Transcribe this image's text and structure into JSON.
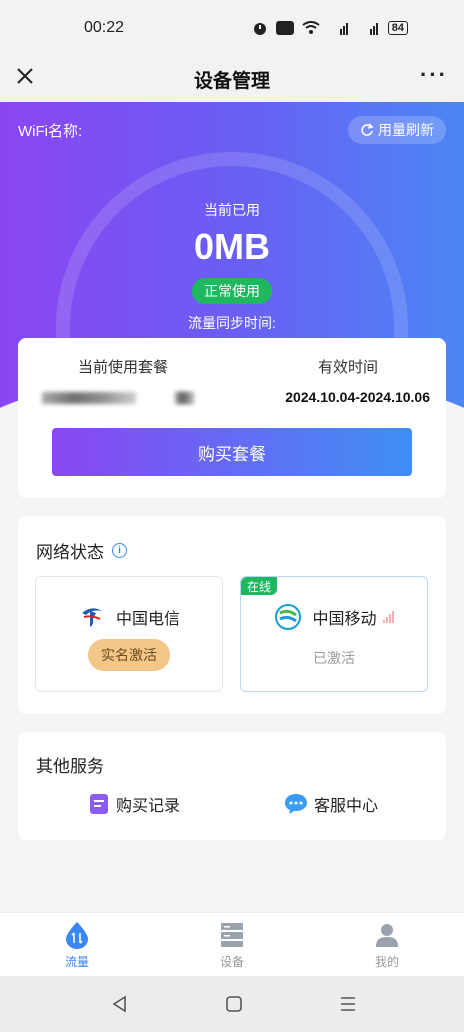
{
  "status_bar": {
    "time": "00:22",
    "battery": "84"
  },
  "header": {
    "title": "设备管理"
  },
  "hero": {
    "wifi_label": "WiFi名称:",
    "refresh_label": "用量刷新",
    "used_label": "当前已用",
    "used_value": "0MB",
    "status": "正常使用",
    "sync_label": "流量同步时间:"
  },
  "plan": {
    "col1_header": "当前使用套餐",
    "col2_header": "有效时间",
    "valid_dates": "2024.10.04-2024.10.06",
    "buy_label": "购买套餐"
  },
  "network": {
    "title": "网络状态",
    "carriers": [
      {
        "name": "中国电信",
        "state": "实名激活"
      },
      {
        "name": "中国移动",
        "state": "已激活",
        "tag": "在线"
      }
    ]
  },
  "services": {
    "title": "其他服务",
    "items": [
      {
        "label": "购买记录",
        "icon": "document-icon"
      },
      {
        "label": "客服中心",
        "icon": "chat-icon"
      }
    ]
  },
  "tabs": [
    {
      "label": "流量",
      "icon": "traffic-icon",
      "active": true
    },
    {
      "label": "设备",
      "icon": "server-icon",
      "active": false
    },
    {
      "label": "我的",
      "icon": "user-icon",
      "active": false
    }
  ],
  "colors": {
    "gradient_start": "#8b45f2",
    "gradient_end": "#4b86f4",
    "success": "#1fb85f",
    "accent": "#3a86f4",
    "pill_orange": "#f3c788"
  }
}
